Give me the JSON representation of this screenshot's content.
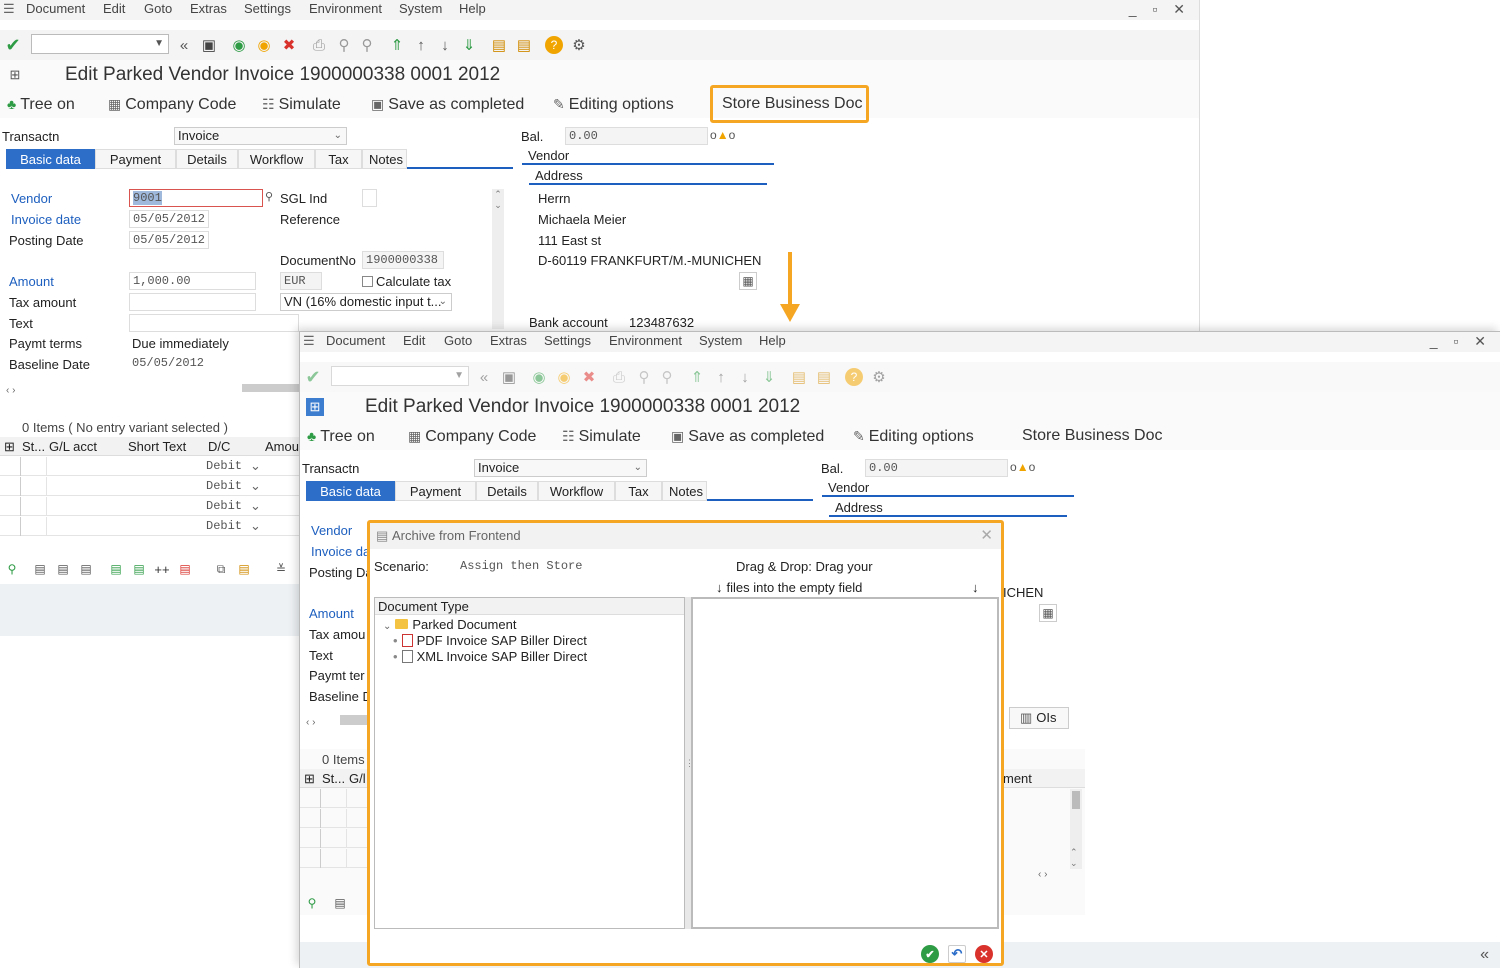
{
  "menu": [
    "Document",
    "Edit",
    "Goto",
    "Extras",
    "Settings",
    "Environment",
    "System",
    "Help"
  ],
  "window_controls": "_ ▫ ✕",
  "title": "Edit Parked Vendor Invoice 1900000338 0001 2012",
  "appbar": {
    "tree_on": "Tree on",
    "company_code": "Company Code",
    "simulate": "Simulate",
    "save_completed": "Save as completed",
    "editing_options": "Editing options",
    "store_business_doc": "Store Business Doc"
  },
  "form": {
    "transactn_label": "Transactn",
    "transactn_value": "Invoice",
    "bal_label": "Bal.",
    "bal_value": "0.00",
    "tabs": [
      "Basic data",
      "Payment",
      "Details",
      "Workflow",
      "Tax",
      "Notes"
    ],
    "vendor_label": "Vendor",
    "vendor_value": "9001",
    "sgl_label": "SGL Ind",
    "invoice_date_label": "Invoice date",
    "invoice_date_value": "05/05/2012",
    "reference_label": "Reference",
    "posting_date_label": "Posting Date",
    "posting_date_value": "05/05/2012",
    "documentno_label": "DocumentNo",
    "documentno_value": "1900000338",
    "amount_label": "Amount",
    "amount_value": "1,000.00",
    "currency": "EUR",
    "calc_tax_label": "Calculate tax",
    "tax_amount_label": "Tax amount",
    "tax_code_value": "VN (16% domestic input t...",
    "text_label": "Text",
    "paymt_terms_label": "Paymt terms",
    "paymt_terms_value": "Due immediately",
    "baseline_label": "Baseline Date",
    "baseline_value": "05/05/2012"
  },
  "vendor_box": {
    "title": "Vendor",
    "address_title": "Address",
    "lines": [
      "Herrn",
      "Michaela Meier",
      "111 East st",
      "D-60119 FRANKFURT/M.-MUNICHEN"
    ],
    "bank_label": "Bank account",
    "bank_value": "123487632"
  },
  "items": {
    "summary": "0 Items ( No entry variant selected )",
    "headers": [
      "St...",
      "G/L acct",
      "Short Text",
      "D/C",
      "Amount"
    ],
    "dc_values": [
      "Debit",
      "Debit",
      "Debit",
      "Debit"
    ]
  },
  "w2": {
    "address_frag": "ICHEN",
    "ois_label": "OIs",
    "items_summary_frag": "0 Items",
    "headers_frag": [
      "St...",
      "G/l"
    ],
    "amount_frag": "ment",
    "form_frags": [
      "Vendor",
      "Invoice da",
      "Posting Da",
      "Amount",
      "Tax amou",
      "Text",
      "Paymt ter",
      "Baseline D"
    ]
  },
  "dialog": {
    "title": "Archive from Frontend",
    "scenario_label": "Scenario:",
    "scenario_value": "Assign then Store",
    "dd_line1": "Drag & Drop: Drag your",
    "dd_line2": "files into the empty field",
    "doc_type_header": "Document Type",
    "tree": {
      "folder": "Parked Document",
      "children": [
        "PDF Invoice SAP Biller Direct",
        "XML Invoice SAP Biller Direct"
      ]
    }
  },
  "colors": {
    "accent": "#1d5fbf",
    "highlight": "#f5a623",
    "ok": "#2e9b45",
    "cancel": "#d9312b"
  }
}
